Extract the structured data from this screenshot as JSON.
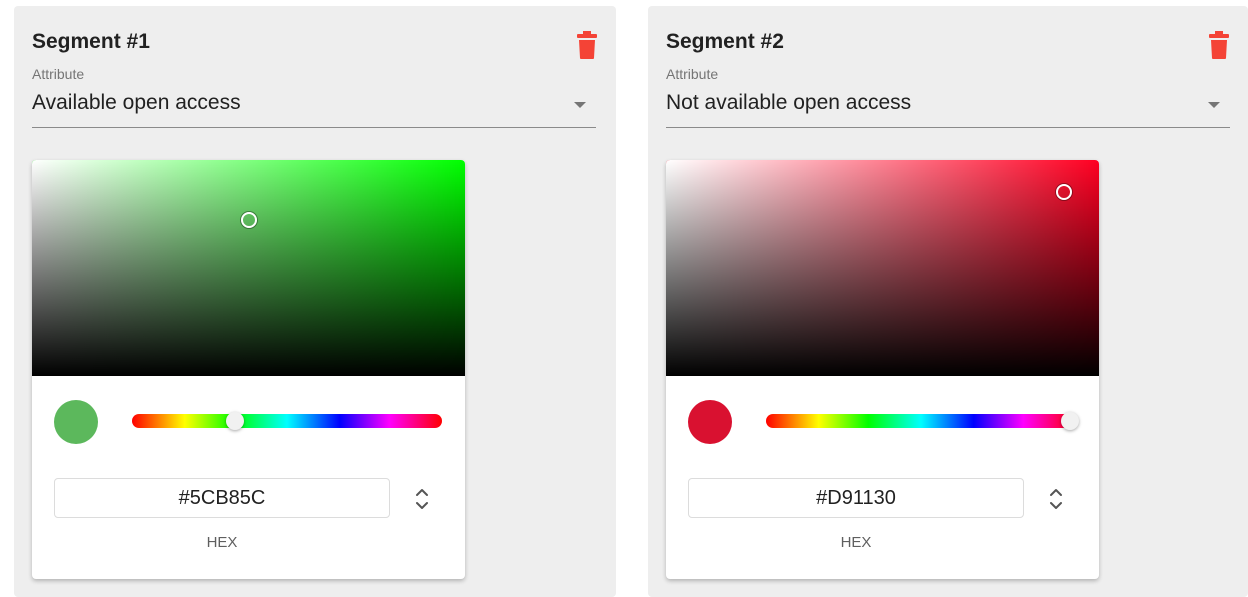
{
  "segments": [
    {
      "title": "Segment #1",
      "attribute_label": "Attribute",
      "attribute_value": "Available open access",
      "color": "#5CB85C",
      "hue_color": "#00ff00",
      "hue_fraction": 0.333,
      "saturation": 0.5,
      "brightness": 0.72,
      "hex_value": "#5CB85C",
      "mode_label": "HEX",
      "delete_icon": "trash-icon",
      "mode_icon": "unfold-icon"
    },
    {
      "title": "Segment #2",
      "attribute_label": "Attribute",
      "attribute_value": "Not available open access",
      "color": "#D91130",
      "hue_color": "#ff0022",
      "hue_fraction": 0.98,
      "saturation": 0.92,
      "brightness": 0.85,
      "hex_value": "#D91130",
      "mode_label": "HEX",
      "delete_icon": "trash-icon",
      "mode_icon": "unfold-icon"
    }
  ],
  "colors": {
    "delete": "#f44336",
    "card_bg": "#eeeeee"
  }
}
